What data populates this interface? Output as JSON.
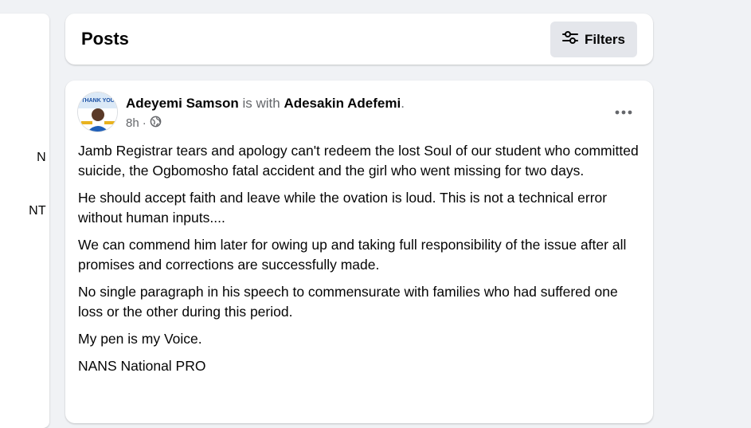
{
  "left_panel": {
    "fragment_1": "N",
    "fragment_2": "NT"
  },
  "posts_header": {
    "title": "Posts",
    "filters_label": "Filters"
  },
  "post": {
    "author": "Adeyemi Samson",
    "with_text": "is with",
    "tagged": "Adesakin Adefemi",
    "period": ".",
    "time": "8h",
    "dot": "·",
    "privacy_icon": "globe-icon",
    "more_icon": "more-horizontal-icon",
    "avatar_text": "THANK YOU",
    "paragraphs": [
      "Jamb Registrar tears and apology can't redeem the lost Soul of our student who committed suicide, the Ogbomosho fatal accident and the girl who went missing for two days.",
      "He should accept faith and leave while the ovation is loud. This is not a technical error without human inputs....",
      "We can commend him later for owing up and taking full responsibility of the issue after all promises and corrections are successfully made.",
      "No single paragraph in his speech to commensurate with families who had suffered one loss or the other during this period.",
      "My pen is my Voice.",
      "NANS National PRO"
    ]
  },
  "colors": {
    "page_bg": "#f0f2f5",
    "card_bg": "#ffffff",
    "button_bg": "#e4e6eb",
    "secondary_text": "#65676b",
    "primary_text": "#050505"
  }
}
